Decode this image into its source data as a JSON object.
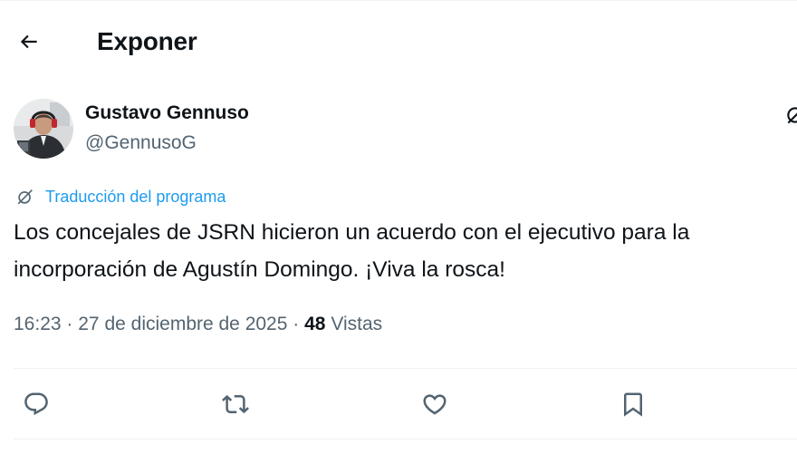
{
  "header": {
    "back_icon": "arrow-left-icon",
    "title": "Exponer"
  },
  "tweet": {
    "author": {
      "display_name": "Gustavo Gennuso",
      "handle": "@GennusoG",
      "avatar": "avatar-photo"
    },
    "translation": {
      "icon": "globe-slash-icon",
      "label": "Traducción del programa"
    },
    "text_lines": [
      "Los concejales de JSRN hicieron un acuerdo con el ejecutivo para la",
      "incorporación de Agustín Domingo. ¡Viva la rosca!"
    ],
    "meta": {
      "time": "16:23",
      "separator": "·",
      "date": "27 de diciembre de 2025",
      "views_count": "48",
      "views_label": "Vistas"
    },
    "actions": [
      {
        "name": "reply",
        "icon": "reply-icon"
      },
      {
        "name": "retweet",
        "icon": "retweet-icon"
      },
      {
        "name": "like",
        "icon": "heart-icon"
      },
      {
        "name": "bookmark",
        "icon": "bookmark-icon"
      }
    ]
  },
  "colors": {
    "text": "#0f1419",
    "secondary": "#536471",
    "link": "#1d9bf0",
    "border": "#eff3f4"
  }
}
